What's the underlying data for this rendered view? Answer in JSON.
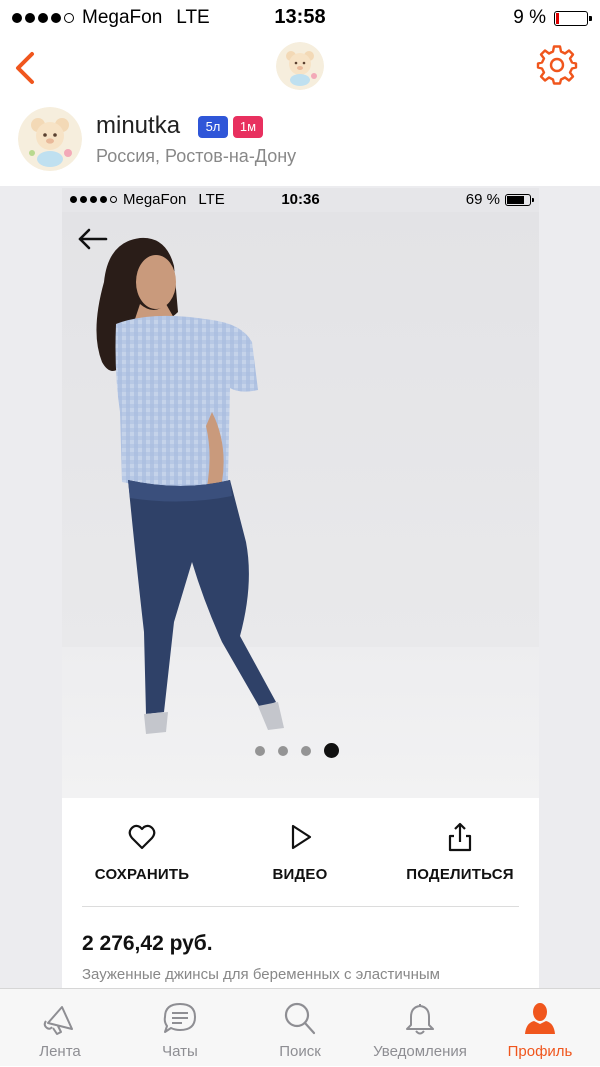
{
  "status_bar": {
    "carrier": "MegaFon",
    "network": "LTE",
    "time": "13:58",
    "battery": "9 %"
  },
  "profile": {
    "name": "minutka",
    "badges": [
      "5л",
      "1м"
    ],
    "city": "Россия, Ростов-на-Дону"
  },
  "post": {
    "inner_status": {
      "carrier": "MegaFon",
      "network": "LTE",
      "time": "10:36",
      "battery": "69 %"
    },
    "pager": {
      "count": 4,
      "active_index": 3
    },
    "actions": [
      {
        "label": "СОХРАНИТЬ",
        "icon": "heart-icon"
      },
      {
        "label": "ВИДЕО",
        "icon": "play-icon"
      },
      {
        "label": "ПОДЕЛИТЬСЯ",
        "icon": "share-icon"
      }
    ],
    "price": "2 276,42 руб.",
    "description": "Зауженные джинсы для беременных с эластичным"
  },
  "tab_bar": {
    "items": [
      {
        "label": "Лента",
        "icon": "megaphone-icon"
      },
      {
        "label": "Чаты",
        "icon": "chat-icon"
      },
      {
        "label": "Поиск",
        "icon": "search-icon"
      },
      {
        "label": "Уведомления",
        "icon": "bell-icon"
      },
      {
        "label": "Профиль",
        "icon": "profile-icon"
      }
    ],
    "active": "Профиль"
  },
  "colors": {
    "accent": "#f0561d",
    "badge_blue": "#2f56d8",
    "badge_pink": "#e8305f"
  }
}
